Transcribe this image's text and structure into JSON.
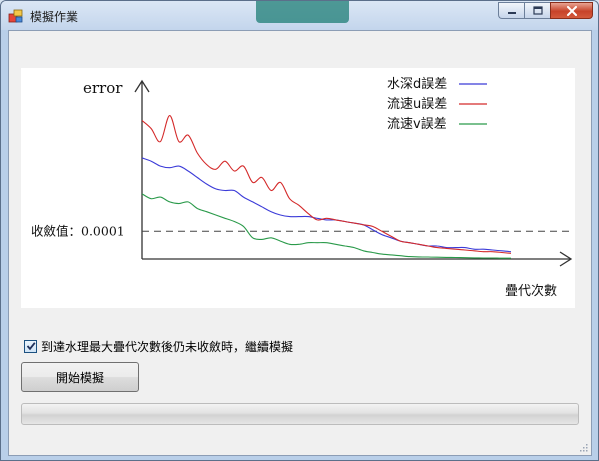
{
  "window": {
    "title": "模擬作業"
  },
  "chart_data": {
    "type": "line",
    "ylabel": "error",
    "xlabel": "疊代次數",
    "threshold": {
      "label": "收斂值：0.0001",
      "style": "dashed"
    },
    "legend_position": "top-right",
    "grid": false,
    "x": [
      0,
      1,
      2,
      3,
      4,
      5,
      6,
      7,
      8,
      9,
      10,
      11,
      12,
      13,
      14,
      15,
      16,
      17,
      18,
      19,
      20,
      21,
      22,
      23,
      24,
      25,
      26,
      27,
      28,
      29,
      30,
      31,
      32,
      33,
      34,
      35,
      36,
      37,
      38,
      39,
      40
    ],
    "series": [
      {
        "name": "水深d誤差",
        "color": "#3b3bd8",
        "values": [
          0.62,
          0.6,
          0.57,
          0.56,
          0.57,
          0.54,
          0.5,
          0.46,
          0.43,
          0.42,
          0.42,
          0.38,
          0.35,
          0.32,
          0.29,
          0.27,
          0.26,
          0.26,
          0.26,
          0.25,
          0.24,
          0.24,
          0.23,
          0.22,
          0.21,
          0.18,
          0.15,
          0.13,
          0.11,
          0.1,
          0.09,
          0.08,
          0.08,
          0.07,
          0.07,
          0.07,
          0.06,
          0.06,
          0.055,
          0.05,
          0.045
        ]
      },
      {
        "name": "流速u誤差",
        "color": "#d42a2a",
        "values": [
          0.85,
          0.8,
          0.72,
          0.88,
          0.72,
          0.76,
          0.65,
          0.58,
          0.55,
          0.6,
          0.54,
          0.57,
          0.47,
          0.5,
          0.42,
          0.47,
          0.37,
          0.33,
          0.28,
          0.24,
          0.25,
          0.24,
          0.23,
          0.22,
          0.21,
          0.2,
          0.17,
          0.14,
          0.11,
          0.1,
          0.09,
          0.08,
          0.07,
          0.065,
          0.06,
          0.055,
          0.05,
          0.045,
          0.045,
          0.04,
          0.035
        ]
      },
      {
        "name": "流速v誤差",
        "color": "#2a9a4a",
        "values": [
          0.4,
          0.37,
          0.38,
          0.35,
          0.34,
          0.35,
          0.31,
          0.29,
          0.27,
          0.25,
          0.23,
          0.2,
          0.13,
          0.12,
          0.13,
          0.11,
          0.09,
          0.09,
          0.1,
          0.1,
          0.1,
          0.09,
          0.08,
          0.07,
          0.05,
          0.04,
          0.03,
          0.025,
          0.02,
          0.015,
          0.013,
          0.012,
          0.011,
          0.01,
          0.009,
          0.008,
          0.007,
          0.006,
          0.006,
          0.005,
          0.005
        ]
      }
    ],
    "threshold_value": 0.17,
    "ylim": [
      0,
      1
    ],
    "xlim": [
      0,
      40
    ]
  },
  "options": {
    "continue_checkbox_label": "到達水理最大疊代次數後仍未收斂時，繼續模擬",
    "continue_checked": true
  },
  "actions": {
    "start_button_label": "開始模擬"
  },
  "progress": {
    "value": 0
  },
  "colors": {
    "axis": "#333333",
    "threshold_line": "#444444"
  }
}
